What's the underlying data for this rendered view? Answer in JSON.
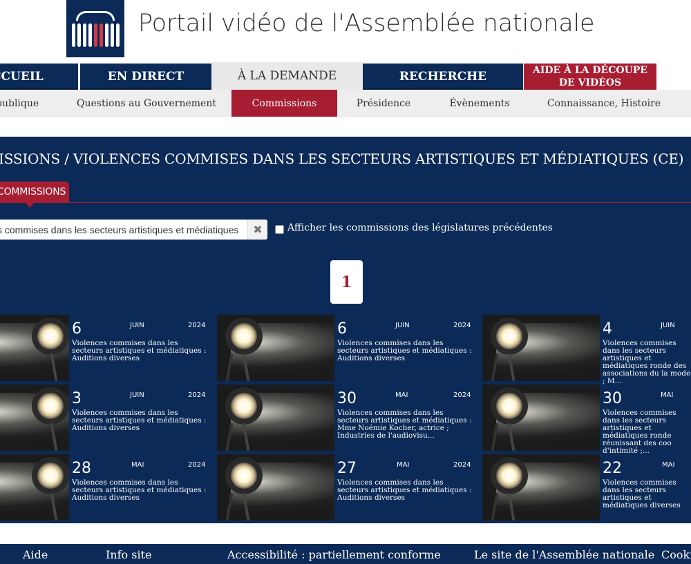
{
  "header": {
    "title": "Portail vidéo de l'Assemblée nationale"
  },
  "main_nav": [
    {
      "label": "CCUEIL",
      "state": "dark"
    },
    {
      "label": "EN DIRECT",
      "state": "dark"
    },
    {
      "label": "À LA DEMANDE",
      "state": "active"
    },
    {
      "label": "RECHERCHE",
      "state": "dark"
    },
    {
      "label_line1": "AIDE À LA DÉCOUPE",
      "label_line2": "DE VIDÉOS",
      "state": "red"
    }
  ],
  "sub_nav": [
    {
      "label": "publique"
    },
    {
      "label": "Questions au Gouvernement"
    },
    {
      "label": "Commissions",
      "active": true
    },
    {
      "label": "Présidence"
    },
    {
      "label": "Évènements"
    },
    {
      "label": "Connaissance, Histoire"
    }
  ],
  "panel": {
    "breadcrumb": "ISSIONS / VIOLENCES COMMISES DANS LES SECTEURS ARTISTIQUES ET MÉDIATIQUES (CE)",
    "tab_label": "COMMISSIONS",
    "search": {
      "value": "s commises dans les secteurs artistiques et médiatiques (",
      "clear_label": "✖"
    },
    "checkbox_label": "Afficher les commissions des législatures précédentes",
    "pager_label": "1"
  },
  "cards": [
    {
      "day": "6",
      "month": "JUIN",
      "year": "2024",
      "desc": "Violences commises dans les secteurs artistiques et médiatiques : Auditions diverses"
    },
    {
      "day": "6",
      "month": "JUIN",
      "year": "2024",
      "desc": "Violences commises dans les secteurs artistiques et médiatiques : Auditions diverses"
    },
    {
      "day": "4",
      "month": "JUIN",
      "year": "",
      "desc": "Violences commises dans les secteurs artistiques et médiatiques ronde des associations du la mode ; M..."
    },
    {
      "day": "3",
      "month": "JUIN",
      "year": "2024",
      "desc": "Violences commises dans les secteurs artistiques et médiatiques : Auditions diverses"
    },
    {
      "day": "30",
      "month": "MAI",
      "year": "2024",
      "desc": "Violences commises dans les secteurs artistiques et médiatiques : Mme Noémie Kocher, actrice ; Industries de l'audiovisu..."
    },
    {
      "day": "30",
      "month": "MAI",
      "year": "",
      "desc": "Violences commises dans les secteurs artistiques et médiatiques ronde réunissant des coo d'intimité ;..."
    },
    {
      "day": "28",
      "month": "MAI",
      "year": "2024",
      "desc": "Violences commises dans les secteurs artistiques et médiatiques : Auditions diverses"
    },
    {
      "day": "27",
      "month": "MAI",
      "year": "2024",
      "desc": "Violences commises dans les secteurs artistiques et médiatiques : Auditions diverses"
    },
    {
      "day": "22",
      "month": "MAI",
      "year": "",
      "desc": "Violences commises dans les secteurs artistiques et médiatiques diverses"
    }
  ],
  "footer": [
    {
      "label": "Aide"
    },
    {
      "label": "Info site"
    },
    {
      "label": "Accessibilité : partiellement conforme"
    },
    {
      "label": "Le site de l'Assemblée nationale"
    },
    {
      "label": "Cookie"
    }
  ],
  "colors": {
    "navy": "#0b2a57",
    "red": "#a71d31",
    "subnav_bg": "#eeeeee"
  }
}
